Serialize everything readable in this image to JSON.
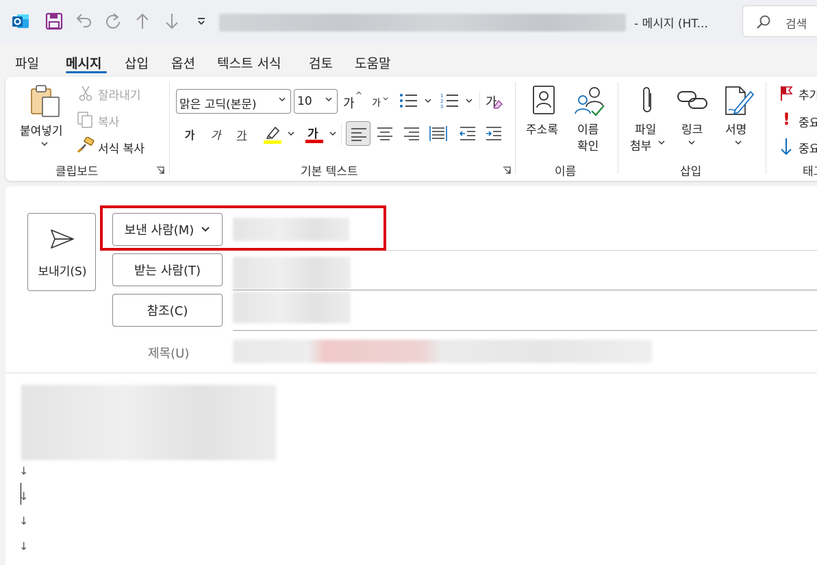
{
  "titlebar": {
    "title_suffix": "-  메시지 (HT...",
    "search_placeholder": "검색"
  },
  "menu": {
    "tabs": [
      "파일",
      "메시지",
      "삽입",
      "옵션",
      "텍스트 서식",
      "검토",
      "도움말"
    ],
    "active_tab": "메시지"
  },
  "ribbon": {
    "clipboard": {
      "paste": "붙여넣기",
      "cut": "잘라내기",
      "copy": "복사",
      "format_painter": "서식 복사",
      "group": "클립보드"
    },
    "basic_text": {
      "font_name": "맑은 고딕(본문)",
      "font_size": "10",
      "grow_font": "가",
      "shrink_font": "가",
      "clear_format": "가",
      "bold": "가",
      "italic": "가",
      "underline": "가",
      "font_color": "가",
      "group": "기본 텍스트"
    },
    "names": {
      "address_book": "주소록",
      "check_names_1": "이름",
      "check_names_2": "확인",
      "group": "이름"
    },
    "insert": {
      "attach_1": "파일",
      "attach_2": "첨부",
      "link": "링크",
      "signature": "서명",
      "group": "삽입"
    },
    "tags": {
      "follow_up": "추가",
      "high_importance": "중요",
      "low_importance": "중요",
      "group": "태그"
    }
  },
  "compose": {
    "send_label": "보내기(S)",
    "from_label": "보낸 사람(M)",
    "to_label": "받는 사람(T)",
    "cc_label": "참조(C)",
    "subject_label": "제목(U)",
    "paragraph_marks": [
      "↓",
      "↓",
      "↓",
      "↓"
    ]
  },
  "colors": {
    "accent": "#0f6cbd",
    "highlight_box": "#d9000d",
    "highlighter": "#ffff00",
    "font_color": "#e00000",
    "save_icon": "#8c2e8c"
  }
}
